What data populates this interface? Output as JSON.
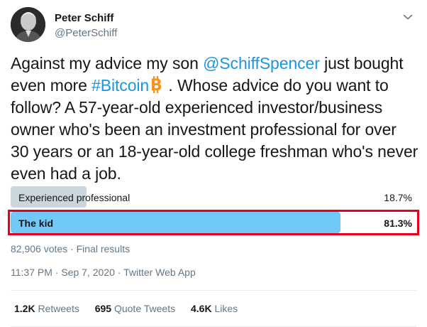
{
  "author": {
    "display_name": "Peter Schiff",
    "handle": "@PeterSchiff"
  },
  "tweet": {
    "text_1": "Against my advice my son ",
    "mention": "@SchiffSpencer",
    "text_2": " just bought even more ",
    "hashtag": "#Bitcoin",
    "text_3": " . Whose advice do you want to follow? A 57-year-old experienced investor/business owner who's been an investment professional for over 30 years or an 18-year-old college freshman who's never even had a job."
  },
  "poll": {
    "options": [
      {
        "label": "Experienced professional",
        "percent": "18.7%",
        "fraction": 0.187
      },
      {
        "label": "The kid",
        "percent": "81.3%",
        "fraction": 0.813
      }
    ],
    "votes": "82,906 votes",
    "status": "Final results"
  },
  "meta": {
    "time": "11:37 PM",
    "date": "Sep 7, 2020",
    "source": "Twitter Web App"
  },
  "stats": {
    "retweets_count": "1.2K",
    "retweets_label": "Retweets",
    "quotes_count": "695",
    "quotes_label": "Quote Tweets",
    "likes_count": "4.6K",
    "likes_label": "Likes"
  },
  "colors": {
    "link": "#1b95e0",
    "winning_bar": "#71c9f8",
    "losing_bar": "#ccd6dd",
    "highlight": "#e3001b",
    "bitcoin": "#f7931a"
  },
  "icons": [
    "chevron-down-icon",
    "bitcoin-emoji"
  ]
}
